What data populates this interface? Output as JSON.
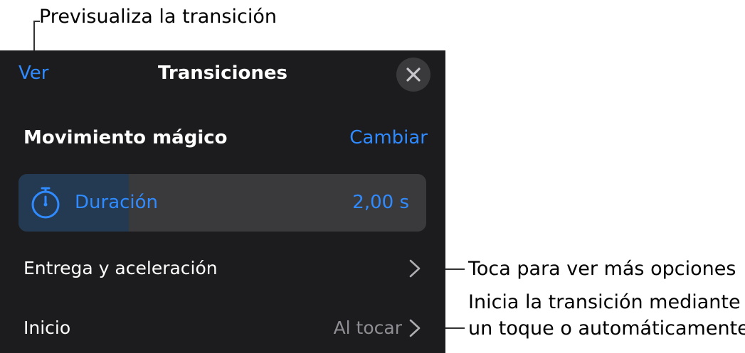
{
  "annotations": {
    "preview": "Previsualiza la transición",
    "more_options": "Toca para ver más opciones",
    "start_line1": "Inicia la transición mediante",
    "start_line2": "un toque o automáticamente"
  },
  "panel": {
    "view_label": "Ver",
    "title": "Transiciones",
    "close_icon": "close-icon"
  },
  "effect": {
    "name": "Movimiento mágico",
    "change_label": "Cambiar"
  },
  "duration": {
    "icon": "timer-icon",
    "label": "Duración",
    "value": "2,00 s",
    "fill_fraction": 0.27
  },
  "rows": [
    {
      "label": "Entrega y aceleración",
      "value": ""
    },
    {
      "label": "Inicio",
      "value": "Al tocar"
    }
  ],
  "colors": {
    "accent": "#2f8bff",
    "panel_bg": "#1c1c1e",
    "slider_bg": "#3a3a3c",
    "slider_fill": "#233a52",
    "secondary_text": "#8e8e93"
  }
}
